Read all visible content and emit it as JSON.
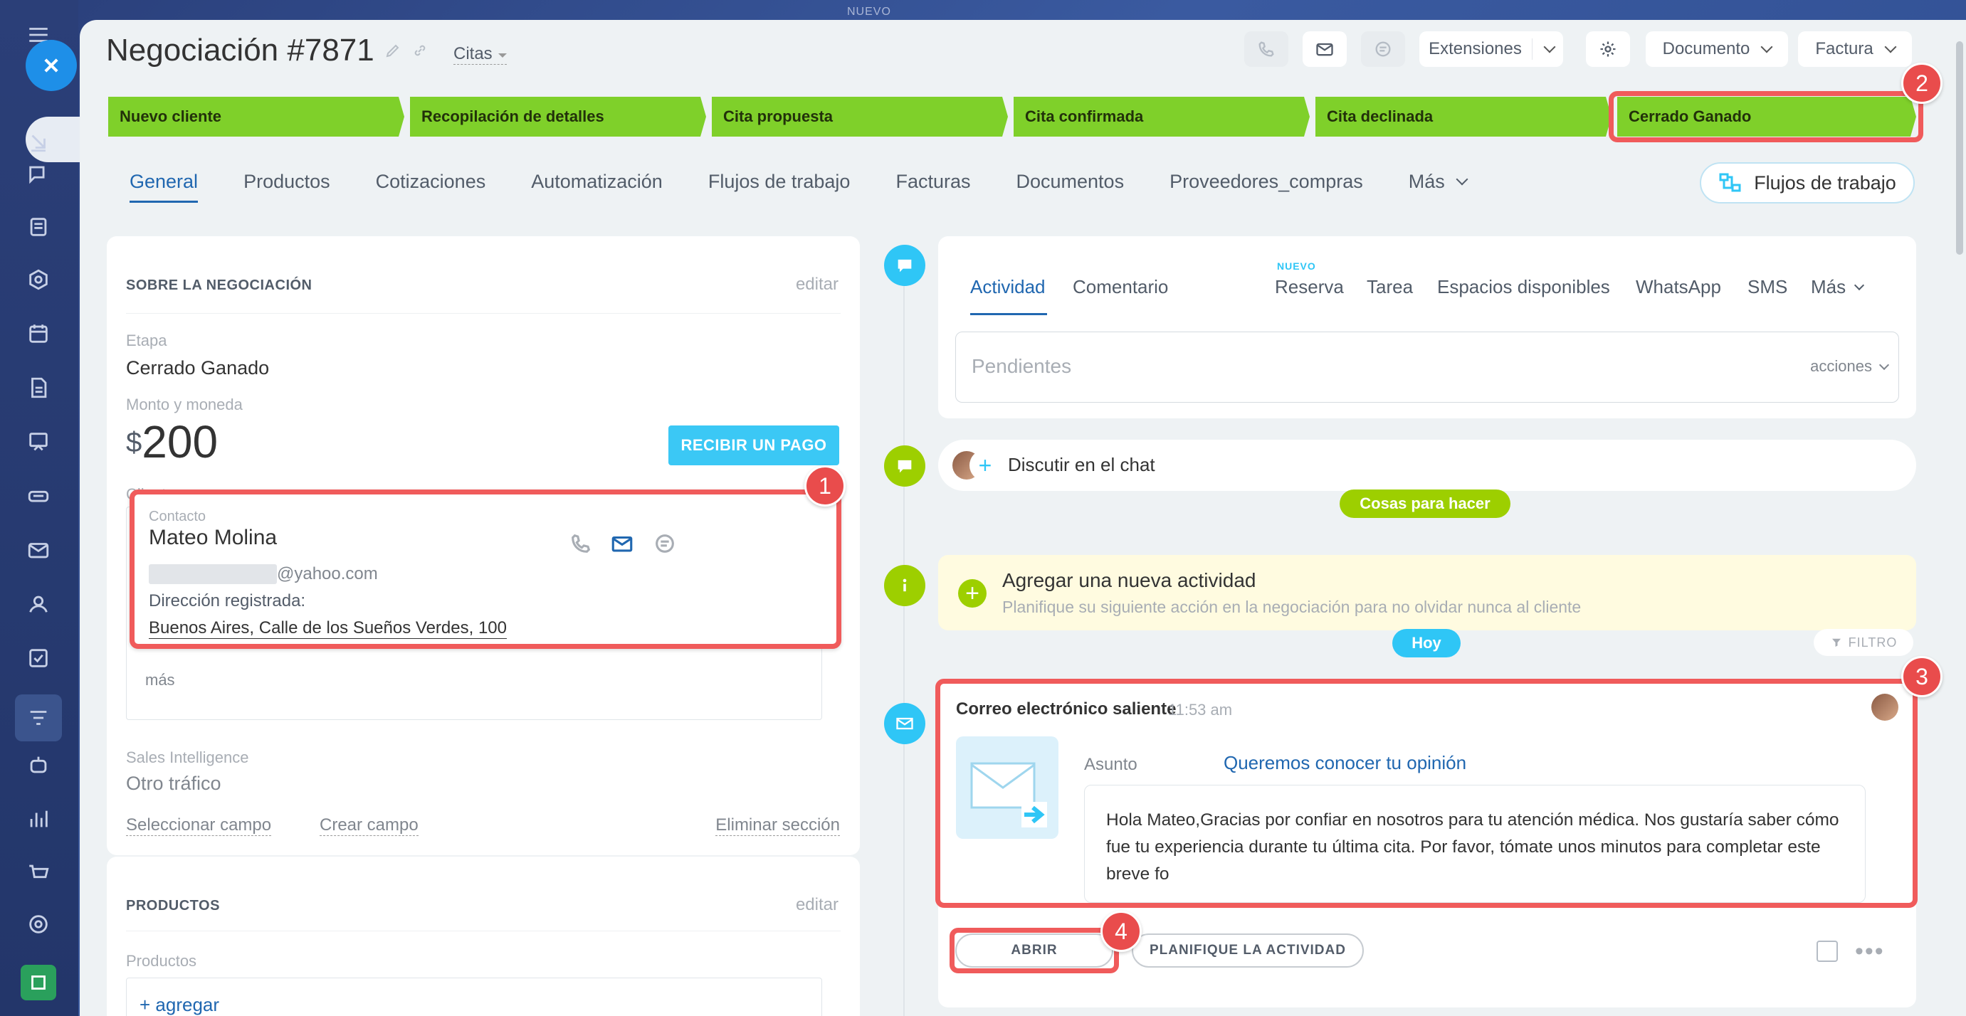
{
  "top_label": "NUEVO",
  "header": {
    "title": "Negociación #7871",
    "category": "Citas",
    "extensions_label": "Extensiones",
    "document_label": "Documento",
    "invoice_label": "Factura"
  },
  "stages": [
    {
      "label": "Nuevo cliente"
    },
    {
      "label": "Recopilación de detalles"
    },
    {
      "label": "Cita propuesta"
    },
    {
      "label": "Cita confirmada"
    },
    {
      "label": "Cita declinada"
    },
    {
      "label": "Cerrado Ganado"
    }
  ],
  "tabs": [
    "General",
    "Productos",
    "Cotizaciones",
    "Automatización",
    "Flujos de trabajo",
    "Facturas",
    "Documentos",
    "Proveedores_compras",
    "Más"
  ],
  "workflow_button": "Flujos de trabajo",
  "about": {
    "heading": "SOBRE LA NEGOCIACIÓN",
    "edit": "editar",
    "stage_label": "Etapa",
    "stage_value": "Cerrado Ganado",
    "amount_label": "Monto y moneda",
    "currency_symbol": "$",
    "amount": "200",
    "pay_button": "RECIBIR UN PAGO",
    "client_label": "Cliente",
    "contact": {
      "label": "Contacto",
      "name": "Mateo Molina",
      "email_domain": "@yahoo.com",
      "address_label": "Dirección registrada:",
      "address": "Buenos Aires, Calle de los Sueños Verdes, 100"
    },
    "more": "más",
    "sales_intel_label": "Sales Intelligence",
    "sales_intel_value": "Otro tráfico",
    "select_field": "Seleccionar campo",
    "create_field": "Crear campo",
    "delete_section": "Eliminar sección"
  },
  "products": {
    "heading": "PRODUCTOS",
    "edit": "editar",
    "label": "Productos",
    "add": "+ agregar"
  },
  "activity": {
    "tabs": [
      "Actividad",
      "Comentario",
      "Reserva",
      "Tarea",
      "Espacios disponibles",
      "WhatsApp",
      "SMS",
      "Más"
    ],
    "new_badge": "NUEVO",
    "pending_placeholder": "Pendientes",
    "actions": "acciones",
    "chat": "Discutir en el chat",
    "todo_pill": "Cosas para hacer",
    "new_activity_title": "Agregar una nueva actividad",
    "new_activity_desc": "Planifique su siguiente acción en la negociación para no olvidar nunca al cliente",
    "today_pill": "Hoy",
    "filter": "FILTRO"
  },
  "email": {
    "title": "Correo electrónico saliente",
    "time": "11:53 am",
    "subject_label": "Asunto",
    "subject": "Queremos conocer tu opinión",
    "body": "Hola Mateo,Gracias por confiar en nosotros para tu atención médica. Nos gustaría saber cómo fue tu experiencia durante tu última cita. Por favor, tómate unos minutos para completar este breve fo",
    "open_button": "ABRIR",
    "plan_button": "PLANIFIQUE LA ACTIVIDAD"
  },
  "badges": [
    "1",
    "2",
    "3",
    "4"
  ],
  "colors": {
    "stage": "#7fd02a",
    "accent": "#2067b0",
    "highlight": "#f05b5b",
    "cyan": "#2fc6f6"
  }
}
